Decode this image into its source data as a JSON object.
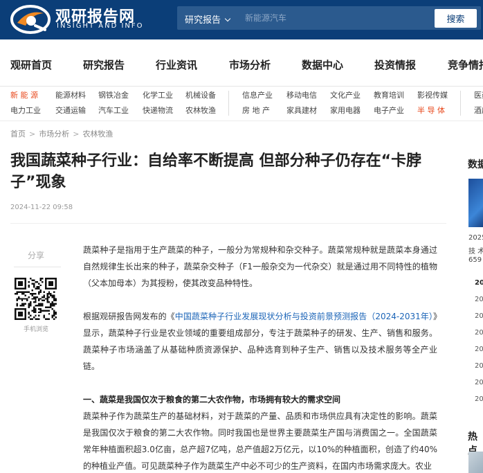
{
  "header": {
    "logo_cn": "观研报告网",
    "logo_en": "INSIGHT AND INFO",
    "search_category": "研究报告",
    "search_placeholder": "新能源汽车",
    "search_button": "搜索",
    "colors": {
      "brand": "#0b3e78",
      "accent": "#e8491d",
      "link": "#1b64b7"
    }
  },
  "main_nav": [
    "观研首页",
    "研究报告",
    "行业资讯",
    "市场分析",
    "数据中心",
    "投资情报",
    "竞争情报"
  ],
  "sub_nav": {
    "row1": [
      "新 能 源",
      "能源材料",
      "钢铁冶金",
      "化学工业",
      "机械设备",
      "信息产业",
      "移动电信",
      "文化产业",
      "教育培训",
      "影视传媒",
      "医药"
    ],
    "row2": [
      "电力工业",
      "交通运输",
      "汽车工业",
      "快递物流",
      "农林牧渔",
      "房 地 产",
      "家具建材",
      "家用电器",
      "电子产业",
      "半 导 体",
      "酒店"
    ]
  },
  "breadcrumb": [
    "首页",
    "市场分析",
    "农林牧渔"
  ],
  "article": {
    "title": "我国蔬菜种子行业：自给率不断提高 但部分种子仍存在“卡脖子”现象",
    "date": "2024-11-22 09:58",
    "share_label": "分享",
    "qr_label": "手机浏览",
    "p1": "蔬菜种子是指用于生产蔬菜的种子，一般分为常规种和杂交种子。蔬菜常规种就是蔬菜本身通过自然规律生长出来的种子，蔬菜杂交种子（F1一般杂交为一代杂交）就是通过用不同特性的植物（父本加母本）为其授粉，使其改变品种特性。",
    "p2_before": "根据观研报告网发布的《",
    "p2_link": "中国蔬菜种子行业发展现状分析与投资前景预测报告（2024-2031年）",
    "p2_after": "》显示，蔬菜种子行业是农业领域的重要组成部分，专注于蔬菜种子的研发、生产、销售和服务。蔬菜种子市场涵盖了从基础种质资源保护、品种选育到种子生产、销售以及技术服务等全产业链。",
    "h1": "一、蔬菜是我国仅次于粮食的第二大农作物，市场拥有较大的需求空间",
    "p3": "蔬菜种子作为蔬菜生产的基础材料，对于蔬菜的产量、品质和市场供应具有决定性的影响。蔬菜是我国仅次于粮食的第二大农作物。同时我国也是世界主要蔬菜生产国与消费国之一。全国蔬菜常年种植面积超3.0亿亩，总产超7亿吨，总产值超2万亿元，以10%的种植面积，创造了约40%的种植业产值。可见蔬菜种子作为蔬菜生产中必不可少的生产资料，在国内市场需求庞大。农业"
  },
  "sidebar": {
    "title": "数据",
    "text_lines": [
      "2025",
      "技 术",
      "659"
    ],
    "years": [
      "20",
      "20",
      "20",
      "20",
      "20",
      "20",
      "20",
      "20"
    ],
    "title2": "热点"
  }
}
